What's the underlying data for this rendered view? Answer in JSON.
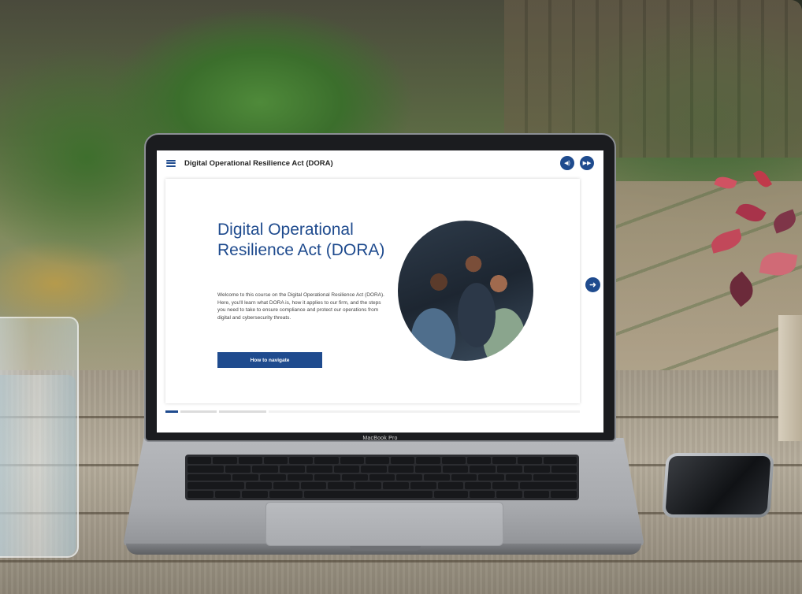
{
  "course": {
    "header_title": "Digital Operational Resilience Act (DORA)",
    "hero_title": "Digital Operational Resilience Act (DORA)",
    "intro_text": "Welcome to this course on the Digital Operational Resilience Act (DORA). Here, you'll learn what DORA is, how it applies to our firm, and the steps you need to take to ensure compliance and protect our operations from digital and cybersecurity threats.",
    "navigate_button": "How to navigate",
    "audio_button_glyph": "◀)",
    "skip_button_glyph": "▶▶",
    "next_button_glyph": "➜",
    "progress_segments_total": 4,
    "progress_segments_active": 1
  },
  "device": {
    "brand_label": "MacBook Pro"
  },
  "colors": {
    "accent": "#1f4b8e",
    "title_text": "#1f4b8e",
    "body_text": "#444444"
  },
  "icons": {
    "menu": "hamburger-menu-icon",
    "audio": "speaker-icon",
    "skip": "fast-forward-icon",
    "next": "arrow-right-icon"
  }
}
